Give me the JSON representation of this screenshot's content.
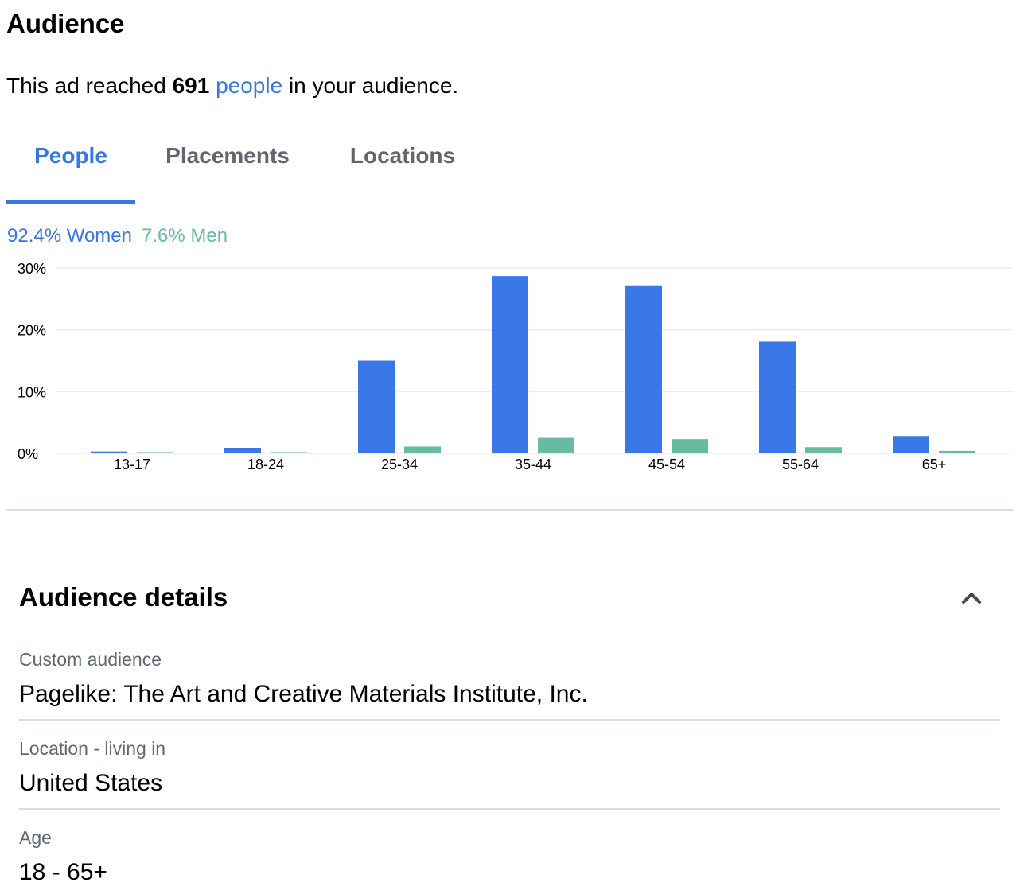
{
  "header": {
    "title": "Audience"
  },
  "summary": {
    "prefix": "This ad reached ",
    "count": "691",
    "link_text": "people",
    "suffix": " in your audience."
  },
  "tabs": [
    {
      "label": "People",
      "active": true
    },
    {
      "label": "Placements",
      "active": false
    },
    {
      "label": "Locations",
      "active": false
    }
  ],
  "legend": {
    "women": "92.4% Women",
    "men": "7.6% Men"
  },
  "colors": {
    "accent": "#3578e5",
    "women_bar": "#3b78e7",
    "men_bar": "#67bba2",
    "grid": "#ebedf0",
    "muted_text": "#606770"
  },
  "chart_data": {
    "type": "bar",
    "categories": [
      "13-17",
      "18-24",
      "25-34",
      "35-44",
      "45-54",
      "55-64",
      "65+"
    ],
    "series": [
      {
        "name": "Women",
        "values": [
          0.3,
          0.9,
          15.0,
          28.7,
          27.2,
          18.1,
          2.8
        ]
      },
      {
        "name": "Men",
        "values": [
          0.2,
          0.1,
          1.1,
          2.5,
          2.3,
          1.0,
          0.4
        ]
      }
    ],
    "yticks": [
      "0%",
      "10%",
      "20%",
      "30%"
    ],
    "ytick_values": [
      0,
      10,
      20,
      30
    ],
    "ylim": [
      0,
      30
    ],
    "grid": true,
    "title": "",
    "xlabel": "",
    "ylabel": ""
  },
  "details": {
    "title": "Audience details",
    "toggle_icon": "chevron-up-icon",
    "items": [
      {
        "label": "Custom audience",
        "value": "Pagelike: The Art and Creative Materials Institute, Inc."
      },
      {
        "label": "Location - living in",
        "value": "United States"
      },
      {
        "label": "Age",
        "value": "18 - 65+"
      }
    ]
  }
}
